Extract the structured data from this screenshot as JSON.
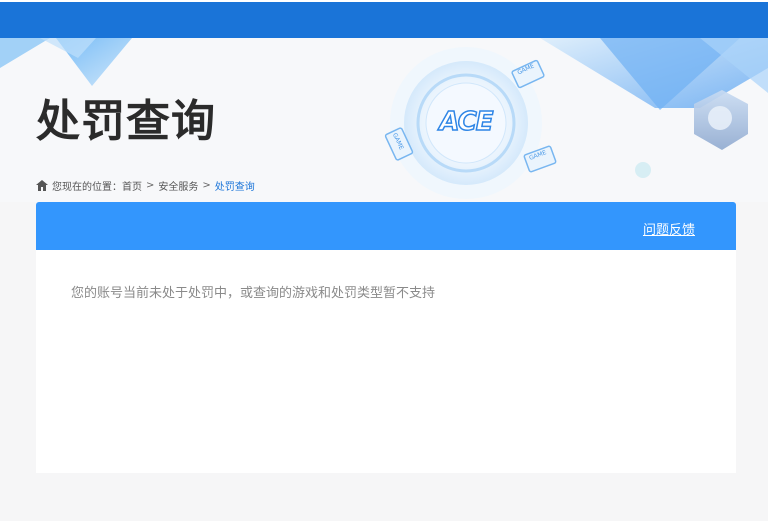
{
  "header": {
    "page_title": "处罚查询",
    "logo_text": "ACE",
    "game_tags": [
      "GAME",
      "GAME",
      "GAME"
    ]
  },
  "breadcrumb": {
    "prefix": "您现在的位置：",
    "items": [
      "首页",
      "安全服务",
      "处罚查询"
    ],
    "separator": ">"
  },
  "panel": {
    "feedback_label": "问题反馈",
    "message": "您的账号当前未处于处罚中，或查询的游戏和处罚类型暂不支持"
  },
  "colors": {
    "top_bar": "#1a74d8",
    "panel_header": "#3396fd",
    "breadcrumb_current": "#1a74d8"
  }
}
